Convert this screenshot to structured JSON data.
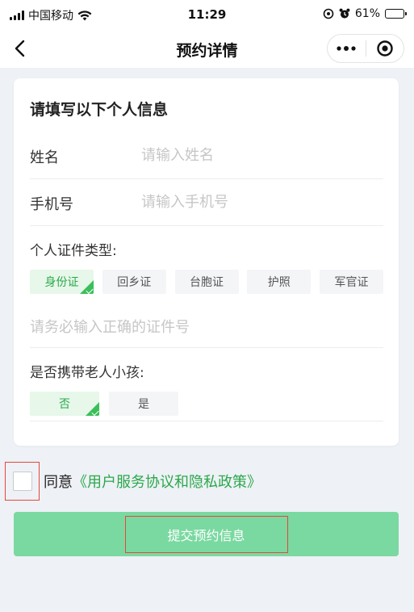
{
  "status_bar": {
    "carrier": "中国移动",
    "time": "11:29",
    "battery": "61%",
    "battery_level": 0.61
  },
  "nav": {
    "title": "预约详情",
    "back_icon": "chevron-left-icon",
    "more_icon": "more-dots-icon",
    "close_icon": "target-circle-icon"
  },
  "form": {
    "title": "请填写以下个人信息",
    "name": {
      "label": "姓名",
      "placeholder": "请输入姓名",
      "value": ""
    },
    "phone": {
      "label": "手机号",
      "placeholder": "请输入手机号",
      "value": ""
    },
    "id_type_label": "个人证件类型:",
    "id_types": [
      "身份证",
      "回乡证",
      "台胞证",
      "护照",
      "军官证"
    ],
    "id_type_selected": "身份证",
    "id_number": {
      "placeholder": "请务必输入正确的证件号",
      "value": ""
    },
    "companion_label": "是否携带老人小孩:",
    "companion_options": [
      "否",
      "是"
    ],
    "companion_selected": "否"
  },
  "agreement": {
    "prefix": "同意",
    "link": "《用户服务协议和隐私政策》",
    "checked": false
  },
  "submit": {
    "label": "提交预约信息"
  },
  "colors": {
    "accent_green": "#2ba84a",
    "submit_bg": "#7ad9a1",
    "highlight_red": "#e5483a",
    "page_bg": "#eef1f6"
  }
}
